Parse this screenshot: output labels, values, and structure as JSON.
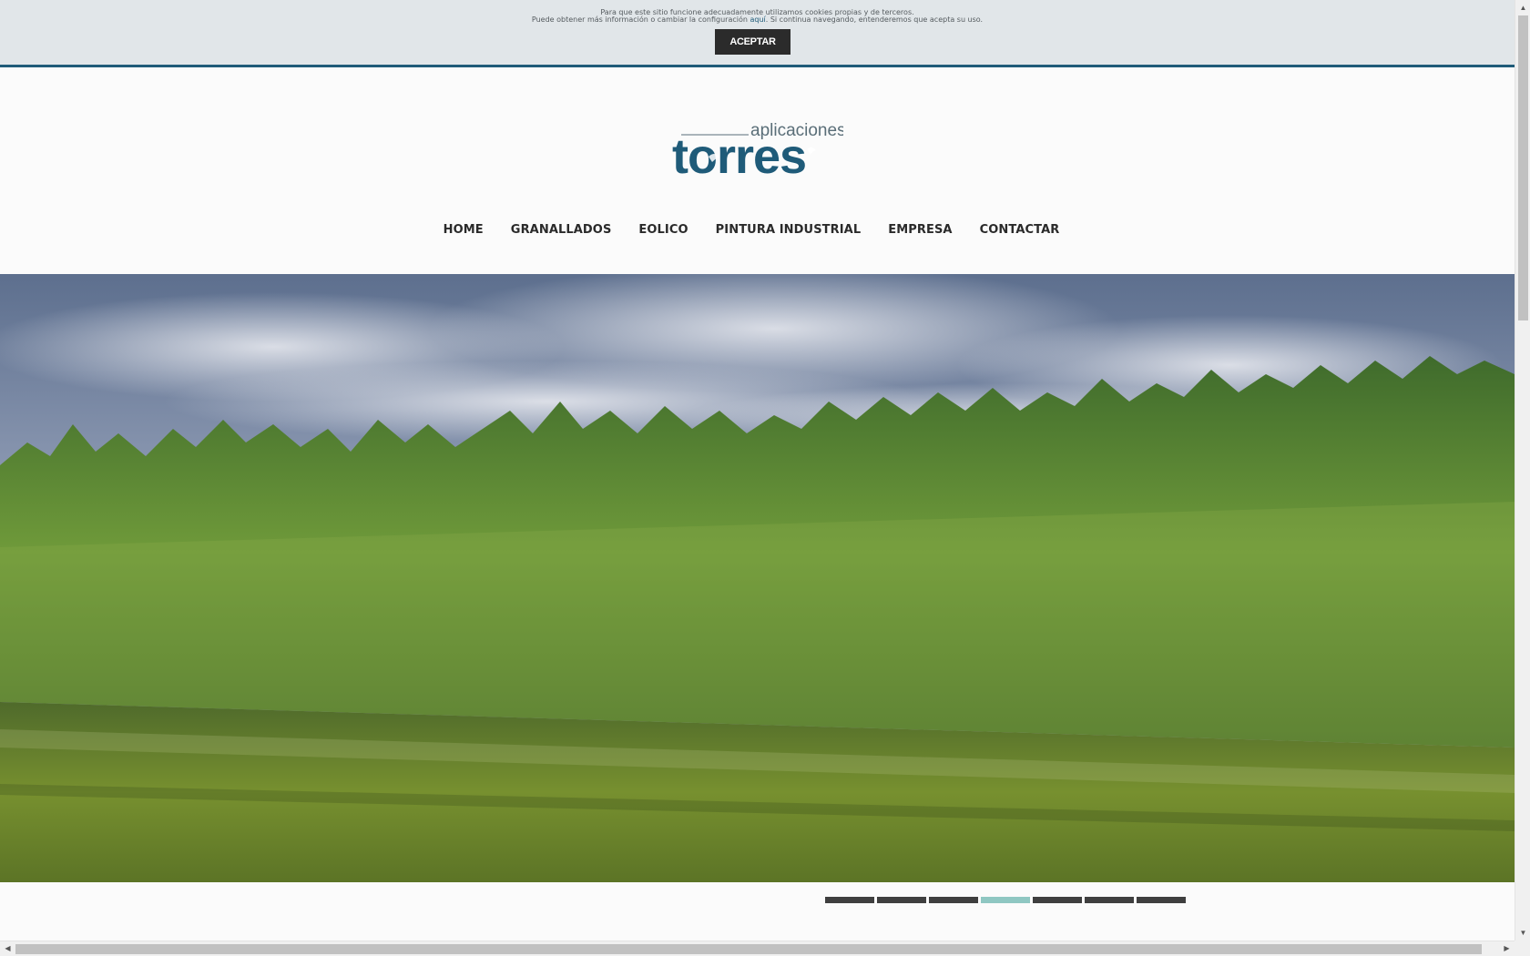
{
  "cookie_bar": {
    "line1": "Para que este sitio funcione adecuadamente utilizamos cookies propias y de terceros.",
    "line2_prefix": "Puede obtener más información o cambiar la configuración ",
    "line2_link": "aquí",
    "line2_suffix": ". Si continua navegando, entenderemos que acepta su uso.",
    "accept_label": "ACEPTAR"
  },
  "logo": {
    "small_text": "aplicaciones",
    "big_text": "torres",
    "brand_color": "#1f5b79"
  },
  "nav": {
    "items": [
      {
        "label": "HOME"
      },
      {
        "label": "GRANALLADOS"
      },
      {
        "label": "EOLICO"
      },
      {
        "label": "PINTURA INDUSTRIAL"
      },
      {
        "label": "EMPRESA"
      },
      {
        "label": "CONTACTAR"
      }
    ]
  },
  "slider": {
    "slide_count": 7,
    "active_index": 3,
    "active_color": "#8fc7c2",
    "inactive_color": "#3f3f3f"
  }
}
